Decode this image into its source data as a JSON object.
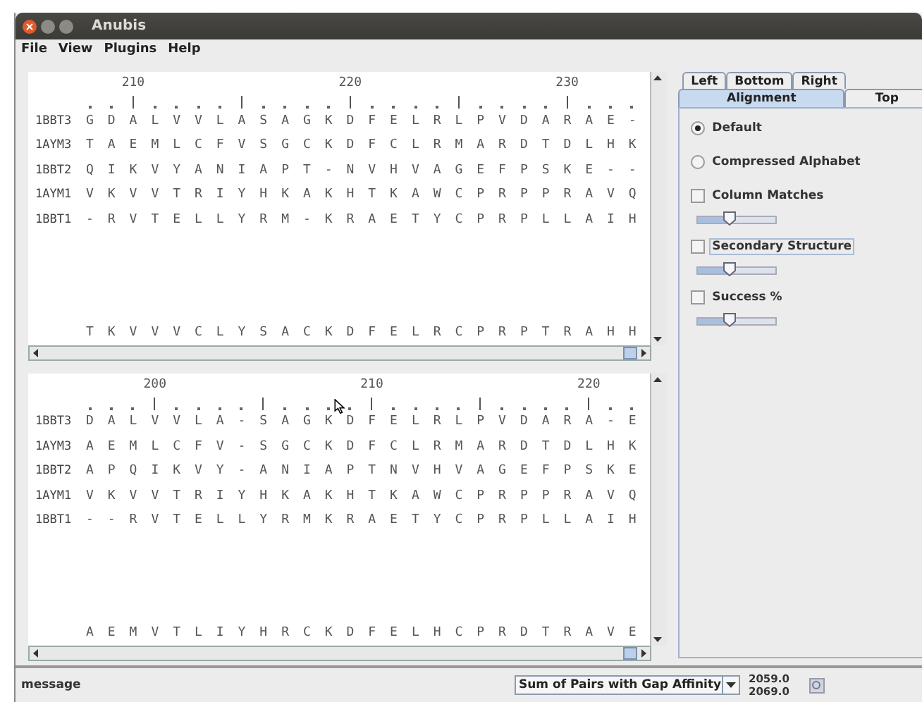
{
  "window": {
    "title": "Anubis"
  },
  "menu": [
    "File",
    "View",
    "Plugins",
    "Help"
  ],
  "panels": [
    {
      "ticks": [
        {
          "kind": "minor"
        },
        {
          "kind": "minor"
        },
        {
          "kind": "major",
          "label": "210"
        },
        {
          "kind": "minor"
        },
        {
          "kind": "minor"
        },
        {
          "kind": "minor"
        },
        {
          "kind": "minor"
        },
        {
          "kind": "major"
        },
        {
          "kind": "minor"
        },
        {
          "kind": "minor"
        },
        {
          "kind": "minor"
        },
        {
          "kind": "minor"
        },
        {
          "kind": "major",
          "label": "220"
        },
        {
          "kind": "minor"
        },
        {
          "kind": "minor"
        },
        {
          "kind": "minor"
        },
        {
          "kind": "minor"
        },
        {
          "kind": "major"
        },
        {
          "kind": "minor"
        },
        {
          "kind": "minor"
        },
        {
          "kind": "minor"
        },
        {
          "kind": "minor"
        },
        {
          "kind": "major",
          "label": "230"
        },
        {
          "kind": "minor"
        },
        {
          "kind": "minor"
        },
        {
          "kind": "minor"
        }
      ],
      "rows": [
        {
          "name": "1BBT3",
          "residues": "G D A L V V L A S A G K D F E L R L P V D A R A E -"
        },
        {
          "name": "1AYM3",
          "residues": "T A E M L C F V S G C K D F C L R M A R D T D L H K"
        },
        {
          "name": "1BBT2",
          "residues": "Q I K V Y A N I A P T - N V H V A G E F P S K E - -"
        },
        {
          "name": "1AYM1",
          "residues": "V K V V T R I Y H K A K H T K A W C P R P P R A V Q"
        },
        {
          "name": "1BBT1",
          "residues": "- R V T E L L Y R M - K R A E T Y C P R P L L A I H"
        }
      ],
      "consensus": "T K V V V C L Y S A C K D F E L R C P R P T R A H H",
      "pointer": false
    },
    {
      "ticks": [
        {
          "kind": "minor"
        },
        {
          "kind": "minor"
        },
        {
          "kind": "minor"
        },
        {
          "kind": "major",
          "label": "200"
        },
        {
          "kind": "minor"
        },
        {
          "kind": "minor"
        },
        {
          "kind": "minor"
        },
        {
          "kind": "minor"
        },
        {
          "kind": "major"
        },
        {
          "kind": "minor"
        },
        {
          "kind": "minor"
        },
        {
          "kind": "minor"
        },
        {
          "kind": "minor"
        },
        {
          "kind": "major",
          "label": "210"
        },
        {
          "kind": "minor"
        },
        {
          "kind": "minor"
        },
        {
          "kind": "minor"
        },
        {
          "kind": "minor"
        },
        {
          "kind": "major"
        },
        {
          "kind": "minor"
        },
        {
          "kind": "minor"
        },
        {
          "kind": "minor"
        },
        {
          "kind": "minor"
        },
        {
          "kind": "major",
          "label": "220"
        },
        {
          "kind": "minor"
        },
        {
          "kind": "minor"
        }
      ],
      "rows": [
        {
          "name": "1BBT3",
          "residues": "D A L V V L A - S A G K D F E L R L P V D A R A - E"
        },
        {
          "name": "1AYM3",
          "residues": "A E M L C F V - S G C K D F C L R M A R D T D L H K"
        },
        {
          "name": "1BBT2",
          "residues": "A P Q I K V Y - A N I A P T N V H V A G E F P S K E"
        },
        {
          "name": "1AYM1",
          "residues": "V K V V T R I Y H K A K H T K A W C P R P P R A V Q"
        },
        {
          "name": "1BBT1",
          "residues": "- - R V T E L L Y R M K R A E T Y C P R P L L A I H"
        }
      ],
      "consensus": "A E M V T L I Y H R C K D F E L H C P R D T R A V E",
      "pointer": true
    }
  ],
  "tabs_row_1": [
    {
      "label": "Left",
      "selected": false
    },
    {
      "label": "Bottom",
      "selected": false
    },
    {
      "label": "Right",
      "selected": false
    }
  ],
  "tabs_row_2": [
    {
      "label": "Alignment",
      "selected": true
    },
    {
      "label": "Top",
      "selected": false
    }
  ],
  "options": [
    {
      "kind": "radio",
      "label": "Default",
      "selected": true
    },
    {
      "kind": "radio",
      "label": "Compressed Alphabet",
      "selected": false
    },
    {
      "kind": "check",
      "label": "Column Matches",
      "checked": false,
      "focused": false,
      "level": 0.42
    },
    {
      "kind": "check",
      "label": "Secondary Structure",
      "checked": false,
      "focused": true,
      "level": 0.42
    },
    {
      "kind": "check",
      "label": "Success %",
      "checked": false,
      "focused": false,
      "level": 0.42
    }
  ],
  "status": {
    "message": "message",
    "scoring": "Sum of Pairs with Gap Affinity",
    "scores": [
      "2059.0",
      "2069.0"
    ]
  }
}
